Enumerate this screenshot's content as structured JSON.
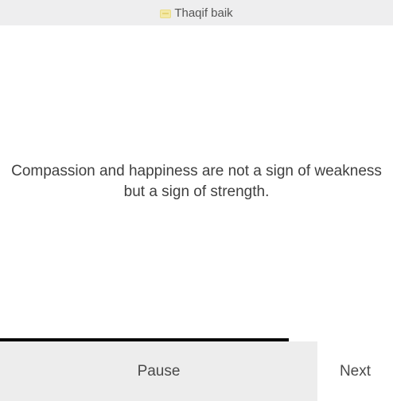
{
  "header": {
    "title": "Thaqif baik",
    "icon": "app-icon"
  },
  "quote": {
    "text": "Compassion and happiness are not a sign of weakness but a sign of strength."
  },
  "progress": {
    "fraction": 0.735
  },
  "controls": {
    "pause_label": "Pause",
    "next_label": "Next"
  }
}
